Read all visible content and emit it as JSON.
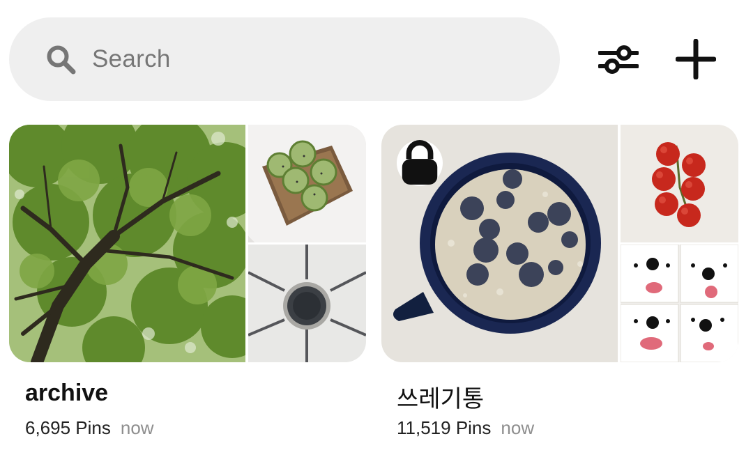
{
  "search": {
    "placeholder": "Search",
    "icon": "search-icon"
  },
  "toolbar": {
    "filter_icon": "filter-sliders-icon",
    "add_icon": "plus-icon"
  },
  "boards": [
    {
      "title": "archive",
      "pins": "6,695 Pins",
      "updated": "now",
      "secret": false,
      "images": [
        "tree-canopy-photo",
        "cucumber-toast-photo",
        "stove-burner-photo"
      ]
    },
    {
      "title": "쓰레기통",
      "pins": "11,519 Pins",
      "updated": "now",
      "secret": true,
      "images": [
        "blueberries-in-milk-photo",
        "cherry-tomatoes-photo",
        "samoyed-faces-photo"
      ]
    }
  ],
  "colors": {
    "search_bg": "#efefef",
    "placeholder": "#767676",
    "meta_time": "#8e8e8e",
    "text": "#111111"
  }
}
